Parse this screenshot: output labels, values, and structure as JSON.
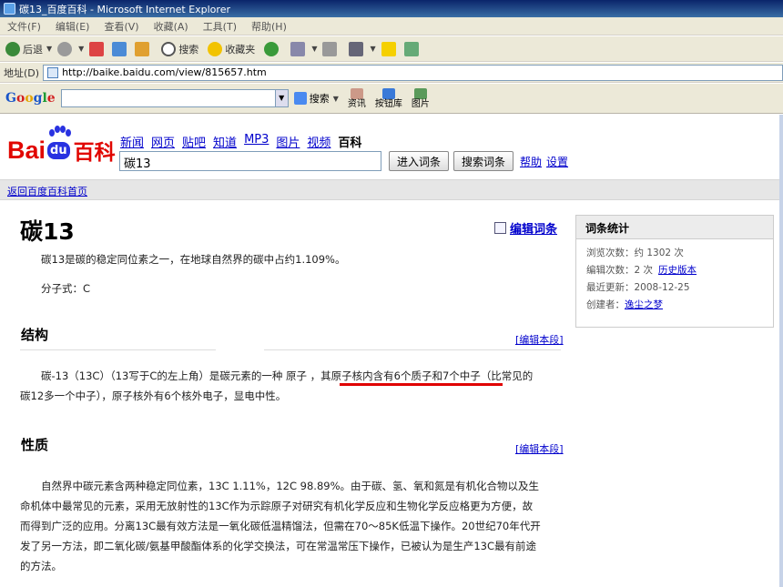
{
  "window": {
    "title": "碳13_百度百科 - Microsoft Internet Explorer"
  },
  "menu": [
    "文件(F)",
    "编辑(E)",
    "查看(V)",
    "收藏(A)",
    "工具(T)",
    "帮助(H)"
  ],
  "toolbar": {
    "back": "后退",
    "search": "搜索",
    "favorites": "收藏夹"
  },
  "address": {
    "label": "地址(D)",
    "url": "http://baike.baidu.com/view/815657.htm"
  },
  "google_bar": {
    "search_label": "搜索",
    "news": "资讯",
    "buttons": "按钮库",
    "images": "图片"
  },
  "site": {
    "logo_bai": "Bai",
    "logo_du": "du",
    "logo_baike": "百科",
    "nav": [
      "新闻",
      "网页",
      "贴吧",
      "知道",
      "MP3",
      "图片",
      "视频"
    ],
    "nav_current": "百科",
    "search_value": "碳13",
    "enter_btn": "进入词条",
    "search_btn": "搜索词条",
    "help": "帮助",
    "settings": "设置",
    "return_link": "返回百度百科首页"
  },
  "article": {
    "title": "碳13",
    "edit_entry": "编辑词条",
    "intro": "碳13是碳的稳定同位素之一，在地球自然界的碳中占约1.109%。",
    "formula": "分子式：C",
    "edit_section": "[编辑本段]",
    "sec1": {
      "heading": "结构",
      "line1_a": "碳-13（13C）（13写于C的左上角）是碳元素的一种 原子 ，",
      "line1_b": "其原子核内含有6个质子和7个中子",
      "line1_c": "（比常见的",
      "line2": "碳12多一个中子），原子核外有6个核外电子，显电中性。"
    },
    "sec2": {
      "heading": "性质",
      "lines": [
        "自然界中碳元素含两种稳定同位素，13C 1.11%，12C 98.89%。由于碳、氢、氧和氮是有机化合物以及生",
        "命机体中最常见的元素，采用无放射性的13C作为示踪原子对研究有机化学反应和生物化学反应格更为方便，故",
        "而得到广泛的应用。分离13C最有效方法是一氧化碳低温精馏法，但需在70～85K低温下操作。20世纪70年代开",
        "发了另一方法，即二氧化碳/氨基甲酸酯体系的化学交换法，可在常温常压下操作，已被认为是生产13C最有前途",
        "的方法。"
      ]
    }
  },
  "stats": {
    "title": "词条统计",
    "views": "浏览次数：约 1302 次",
    "edits": "编辑次数：2 次",
    "history": "历史版本",
    "updated": "最近更新：2008-12-25",
    "creator_label": "创建者：",
    "creator": "逸尘之梦"
  }
}
